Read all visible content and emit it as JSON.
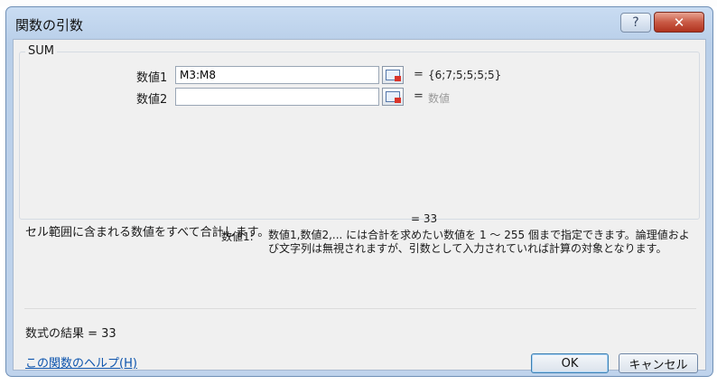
{
  "window": {
    "title": "関数の引数",
    "help_glyph": "?",
    "close_glyph": "✕"
  },
  "group": {
    "label": "SUM",
    "args": [
      {
        "label": "数値1",
        "value": "M3:M8",
        "result": "{6;7;5;5;5;5}"
      },
      {
        "label": "数値2",
        "value": "",
        "result": "数値"
      }
    ],
    "equals": "="
  },
  "total": "=   33",
  "description": "セル範囲に含まれる数値をすべて合計します。",
  "arg_description": {
    "name": "数値1:",
    "text": "数値1,数値2,... には合計を求めたい数値を 1 ～ 255 個まで指定できます。論理値および文字列は無視されますが、引数として入力されていれば計算の対象となります。"
  },
  "formula_result": "数式の結果 =  33",
  "help_link": "この関数のヘルプ(H)",
  "buttons": {
    "ok": "OK",
    "cancel": "キャンセル"
  },
  "icons": {
    "ref": "range-select-icon",
    "help": "help-icon",
    "close": "close-icon"
  }
}
